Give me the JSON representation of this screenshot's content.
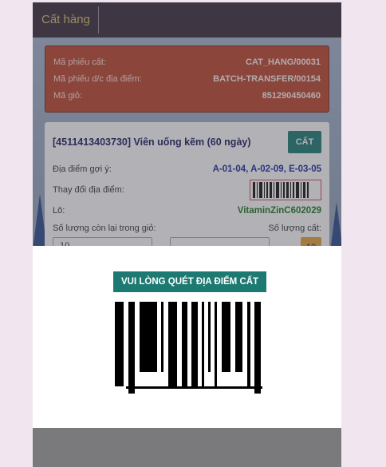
{
  "app_bar": {
    "title": "Cất hàng"
  },
  "info": {
    "rows": [
      {
        "label": "Mã phiếu cất:",
        "value": "CAT_HANG/00031"
      },
      {
        "label": "Mã phiếu d/c địa điểm:",
        "value": "BATCH-TRANSFER/00154"
      },
      {
        "label": "Mã giỏ:",
        "value": "851290450460"
      }
    ]
  },
  "product": {
    "title": "[4511413403730] Viên uống kẽm (60 ngày)",
    "button_label": "CẤT",
    "suggested_label": "Địa điểm gợi ý:",
    "suggested_value": "A-01-04, A-02-09, E-03-05",
    "change_label": "Thay đổi địa điểm:",
    "lot_label": "Lô:",
    "lot_value": "VitaminZinC602029",
    "remaining_label": "Số lượng còn lại trong giỏ:",
    "qty_label": "Số lượng cất:",
    "remaining_value": "10",
    "qty_value": "",
    "qty_badge": "10"
  },
  "modal": {
    "title": "VUI LÒNG QUÉT ĐỊA ĐIỂM CẤT"
  },
  "colors": {
    "app_bar_bg": "#3c2b3c",
    "app_bar_text": "#d8c06a",
    "info_card_bg": "#c0462c",
    "accent_teal": "#1d7a73",
    "lot_green": "#1a7a1a",
    "location_blue": "#1a2a9c"
  }
}
